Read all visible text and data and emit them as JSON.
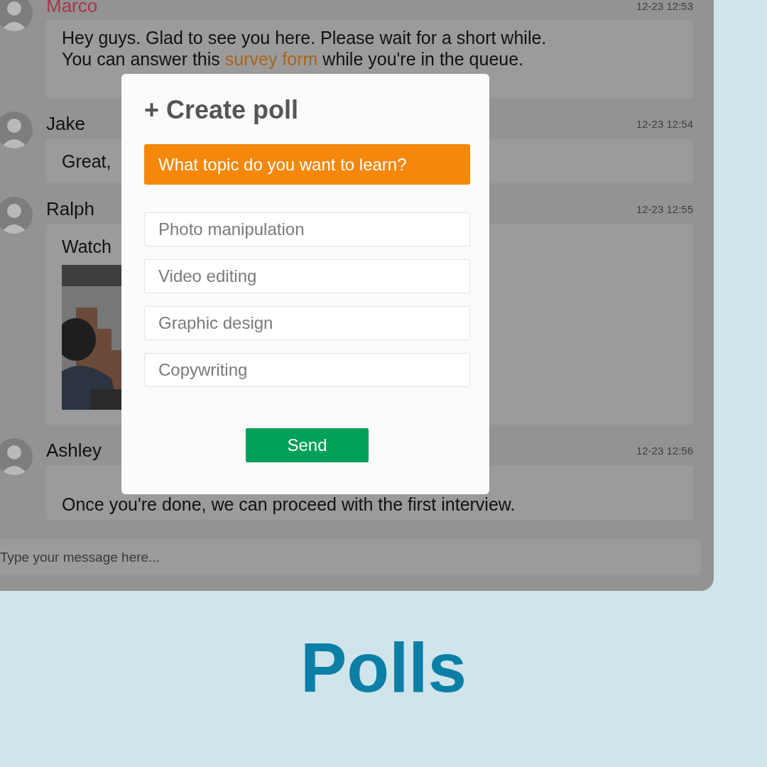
{
  "chat": {
    "messages": [
      {
        "sender": "Marco",
        "highlight_name": true,
        "time": "12-23 12:53",
        "text_before": "Hey guys. Glad to see you here. Please wait for a short while. You can answer this ",
        "link": "survey form",
        "text_after": " while you're in the queue."
      },
      {
        "sender": "Jake",
        "highlight_name": false,
        "time": "12-23 12:54",
        "text_before": "Great,"
      },
      {
        "sender": "Ralph",
        "highlight_name": false,
        "time": "12-23 12:55",
        "text_before": "Watch"
      },
      {
        "sender": "Ashley",
        "highlight_name": false,
        "time": "12-23 12:56",
        "text_before": "Once you're done, we can proceed with the first interview."
      }
    ],
    "input": {
      "placeholder": "Type your message here..."
    }
  },
  "poll_dialog": {
    "title": "+ Create poll",
    "question": "What topic do you want to learn?",
    "options": [
      {
        "placeholder": "Photo manipulation"
      },
      {
        "placeholder": "Video editing"
      },
      {
        "placeholder": "Graphic design"
      },
      {
        "placeholder": "Copywriting"
      }
    ],
    "send_button": "Send"
  },
  "caption": "Polls"
}
